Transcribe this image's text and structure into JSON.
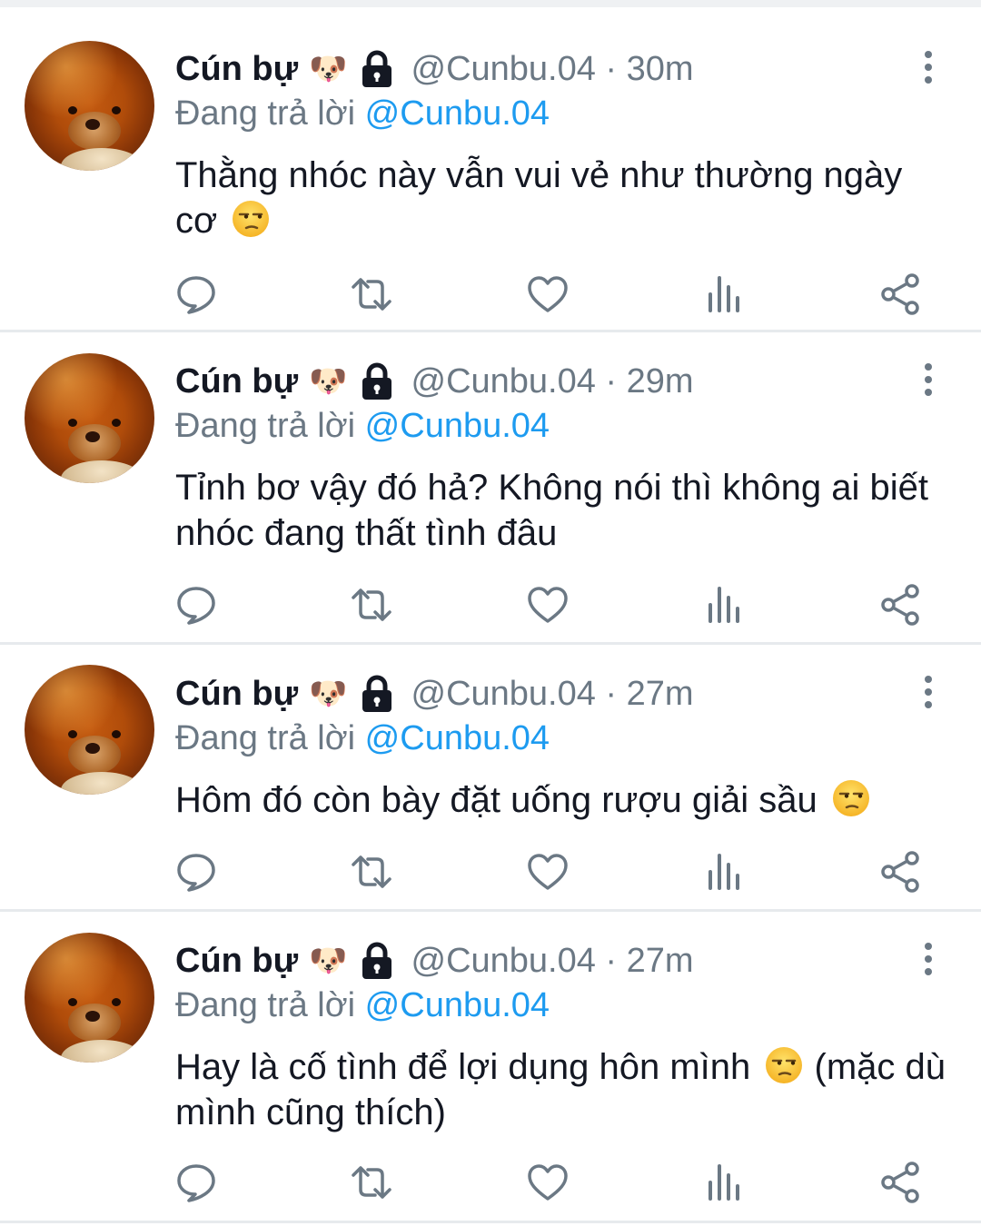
{
  "colors": {
    "name": "#141823",
    "meta": "#6b7884",
    "mention": "#1d9bf0",
    "icon": "#6b7884",
    "divider": "#e7eaed"
  },
  "icons": {
    "reply": "speech-bubble-icon",
    "retweet": "retweet-icon",
    "like": "heart-icon",
    "views": "bar-chart-icon",
    "share": "share-icon",
    "more": "vertical-ellipsis-icon",
    "lock": "lock-icon",
    "dog": "dog-face-emoji",
    "unamused": "unamused-face-emoji"
  },
  "tweets": [
    {
      "name": "Cún bự",
      "dog": "🐶",
      "handle_time": "@Cunbu.04 · 30m",
      "replying_prefix": "Đang trả lời",
      "replying_handle": "@Cunbu.04",
      "text_before": "Thằng nhóc này vẫn vui vẻ như thường ngày cơ",
      "text_after": ""
    },
    {
      "name": "Cún bự",
      "dog": "🐶",
      "handle_time": "@Cunbu.04 · 29m",
      "replying_prefix": "Đang trả lời",
      "replying_handle": "@Cunbu.04",
      "text_before": "Tỉnh bơ vậy đó hả? Không nói thì không ai biết nhóc đang thất tình đâu",
      "text_after": ""
    },
    {
      "name": "Cún bự",
      "dog": "🐶",
      "handle_time": "@Cunbu.04 · 27m",
      "replying_prefix": "Đang trả lời",
      "replying_handle": "@Cunbu.04",
      "text_before": "Hôm đó còn bày đặt uống rượu giải sầu",
      "text_after": ""
    },
    {
      "name": "Cún bự",
      "dog": "🐶",
      "handle_time": "@Cunbu.04 · 27m",
      "replying_prefix": "Đang trả lời",
      "replying_handle": "@Cunbu.04",
      "text_before": "Hay là cố tình để lợi dụng hôn mình",
      "text_after": " (mặc dù mình cũng thích)"
    }
  ]
}
